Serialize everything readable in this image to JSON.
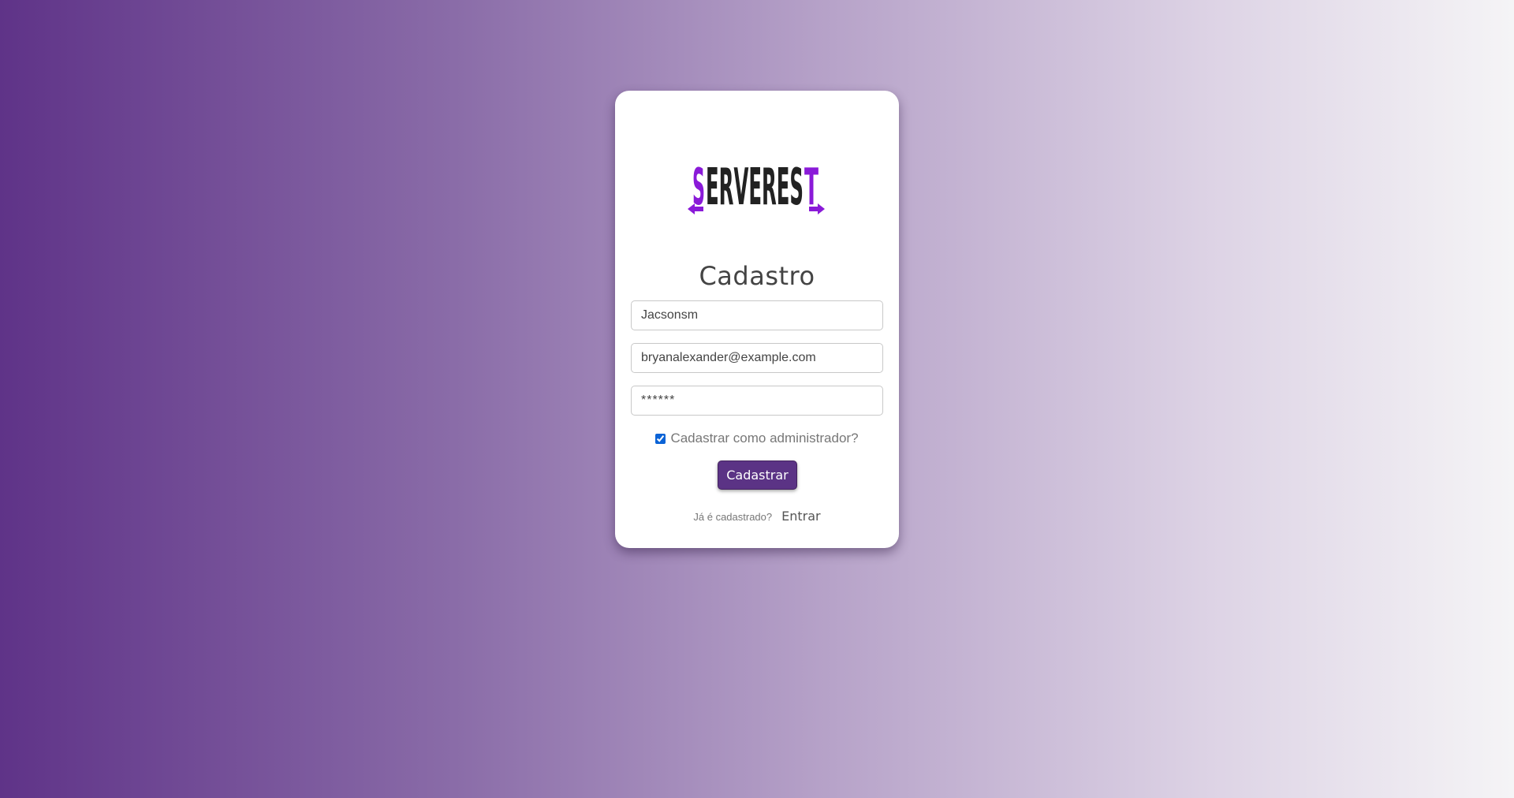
{
  "logo": {
    "text": "SERVEREST",
    "colors": {
      "dark": "#222222",
      "accent": "#8a1ad8"
    }
  },
  "form": {
    "title": "Cadastro",
    "name_value": "Jacsonsm",
    "email_value": "bryanalexander@example.com",
    "password_value": "******",
    "admin_label": "Cadastrar como administrador?",
    "admin_checked": true,
    "submit_label": "Cadastrar"
  },
  "footer": {
    "already_text": "Já é cadastrado?",
    "login_link": "Entrar"
  },
  "colors": {
    "button": "#5b3385",
    "gradient_start": "#5f3388",
    "gradient_end": "#f5f4f6"
  }
}
